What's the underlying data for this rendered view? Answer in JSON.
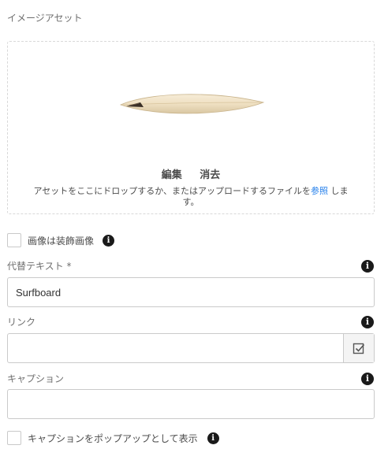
{
  "section_title": "イメージアセット",
  "asset": {
    "image_name": "surfboard-image",
    "edit_label": "編集",
    "clear_label": "消去",
    "drop_hint_text": "アセットをここにドロップするか、またはアップロードするファイルを",
    "browse_label": "参照",
    "drop_hint_suffix": "します。"
  },
  "decorative": {
    "label": "画像は装飾画像",
    "checked": false
  },
  "alt_text": {
    "label": "代替テキスト *",
    "value": "Surfboard"
  },
  "link": {
    "label": "リンク",
    "value": ""
  },
  "caption": {
    "label": "キャプション",
    "value": ""
  },
  "caption_popup": {
    "label": "キャプションをポップアップとして表示",
    "checked": false
  },
  "info_glyph": "i",
  "colors": {
    "link_blue": "#2680eb",
    "info_icon": "#1a1a1a",
    "border": "#cacaca"
  }
}
